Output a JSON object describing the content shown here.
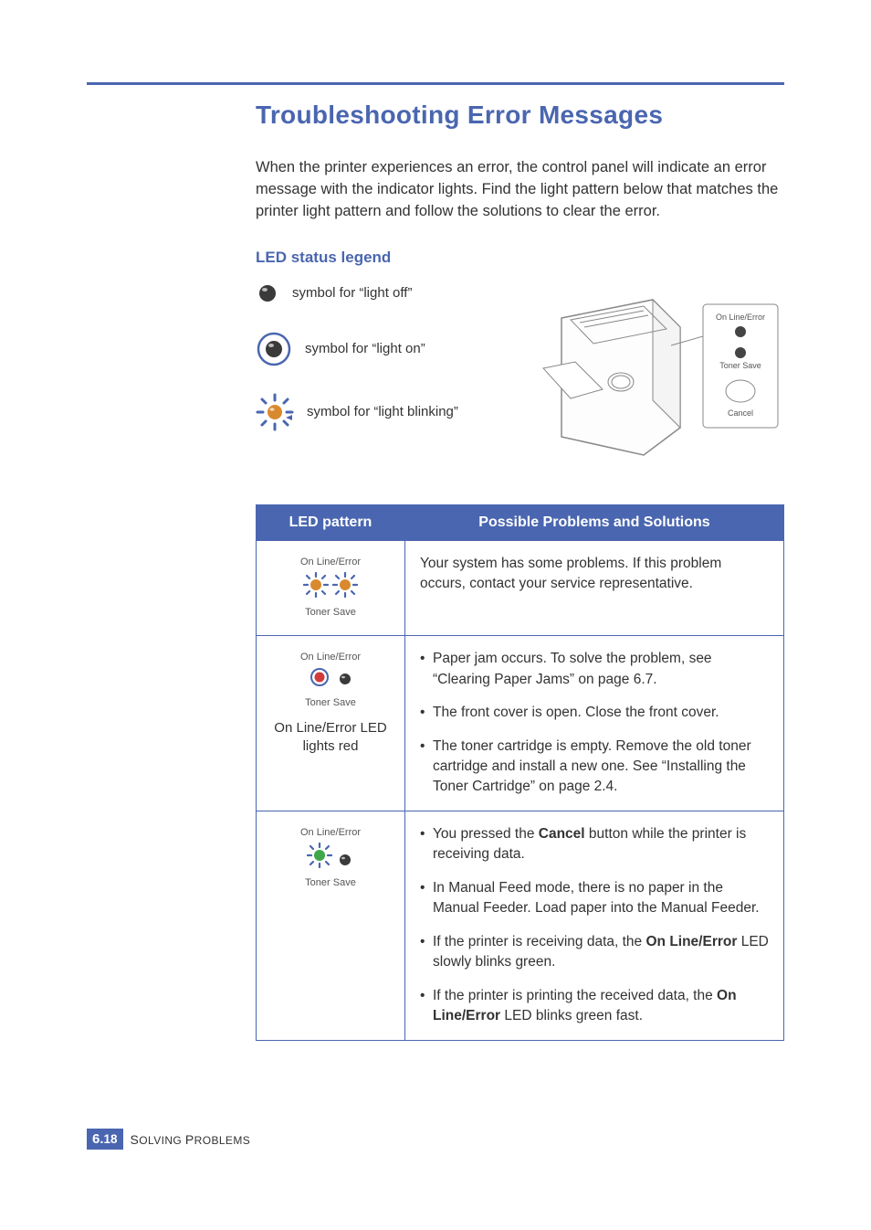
{
  "title": "Troubleshooting Error Messages",
  "intro": "When the printer experiences an error, the control panel will indicate an error message with the indicator lights. Find the light pattern below that matches the printer light pattern and follow the solutions to clear the error.",
  "legend_heading": "LED status legend",
  "legend": {
    "off": "symbol for “light off”",
    "on": "symbol for “light on”",
    "blink": "symbol for “light blinking”"
  },
  "panel_labels": {
    "online_error": "On Line/Error",
    "toner_save": "Toner Save",
    "cancel": "Cancel"
  },
  "table": {
    "headers": {
      "led": "LED pattern",
      "problem": "Possible Problems and Solutions"
    },
    "rows": [
      {
        "led": {
          "top_label": "On Line/Error",
          "top_state": "blink-orange",
          "bottom_label": "Toner Save",
          "bottom_state": "blink-orange",
          "caption": ""
        },
        "solution_text": "Your system has some problems. If this problem occurs, contact your service representative."
      },
      {
        "led": {
          "top_label": "On Line/Error",
          "top_state": "on-red",
          "bottom_label": "Toner Save",
          "bottom_state": "off",
          "caption": "On Line/Error LED lights red"
        },
        "bullets": [
          "Paper jam occurs. To solve the problem, see “Clearing Paper Jams” on page 6.7.",
          "The front cover is open. Close the front cover.",
          "The toner cartridge is empty. Remove the old toner cartridge and install a new one. See “Installing the Toner Cartridge” on page 2.4."
        ]
      },
      {
        "led": {
          "top_label": "On Line/Error",
          "top_state": "blink-green",
          "bottom_label": "Toner Save",
          "bottom_state": "off",
          "caption": ""
        },
        "bullets_rich": [
          {
            "pre": "You pressed the ",
            "bold": "Cancel",
            "post": " button while the printer is receiving data."
          },
          {
            "text": "In Manual Feed mode, there is no paper in the Manual Feeder. Load paper into the Manual Feeder."
          },
          {
            "pre": "If the printer is receiving data, the ",
            "bold": "On Line/Error",
            "post": " LED slowly blinks green."
          },
          {
            "pre": "If the printer is printing the received data, the ",
            "bold": "On Line/Error",
            "post": " LED blinks green fast."
          }
        ]
      }
    ]
  },
  "footer": {
    "chapter": "6.",
    "page": "18",
    "section_first": "S",
    "section_rest1": "OLVING ",
    "section_first2": "P",
    "section_rest2": "ROBLEMS"
  },
  "chart_data": null
}
